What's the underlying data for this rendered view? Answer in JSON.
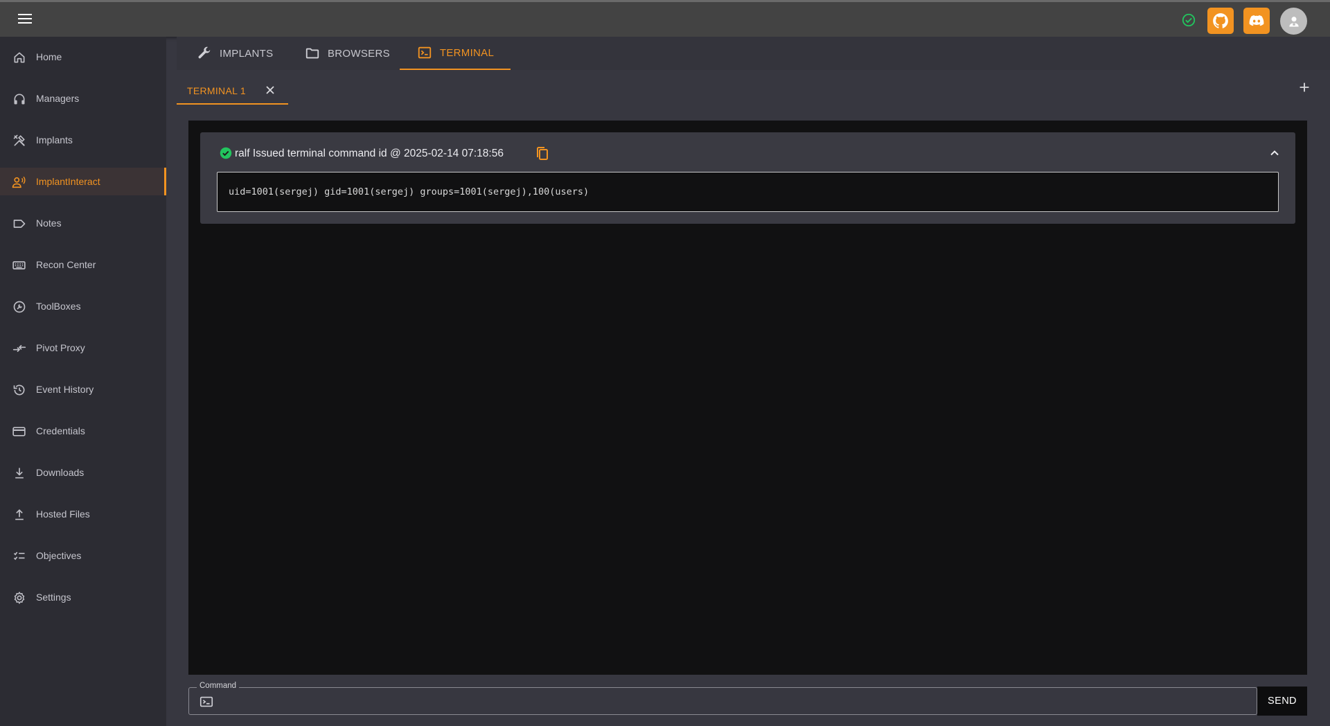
{
  "header": {
    "menu_icon": "hamburger-menu-icon",
    "status_icon": "check-circle-icon",
    "github_icon": "github-icon",
    "discord_icon": "discord-icon",
    "avatar_icon": "user-avatar-icon",
    "accent_color": "#f29321",
    "status_color": "#22c55e"
  },
  "sidebar": {
    "items": [
      {
        "label": "Home",
        "icon": "home-icon",
        "active": false
      },
      {
        "label": "Managers",
        "icon": "headphones-icon",
        "active": false
      },
      {
        "label": "Implants",
        "icon": "tools-icon",
        "active": false
      },
      {
        "label": "ImplantInteract",
        "icon": "person-interact-icon",
        "active": true
      },
      {
        "label": "Notes",
        "icon": "label-icon",
        "active": false
      },
      {
        "label": "Recon Center",
        "icon": "keyboard-icon",
        "active": false
      },
      {
        "label": "ToolBoxes",
        "icon": "wrench-circle-icon",
        "active": false
      },
      {
        "label": "Pivot Proxy",
        "icon": "arrows-icon",
        "active": false
      },
      {
        "label": "Event History",
        "icon": "history-icon",
        "active": false
      },
      {
        "label": "Credentials",
        "icon": "credit-card-icon",
        "active": false
      },
      {
        "label": "Downloads",
        "icon": "download-icon",
        "active": false
      },
      {
        "label": "Hosted Files",
        "icon": "upload-icon",
        "active": false
      },
      {
        "label": "Objectives",
        "icon": "checklist-icon",
        "active": false
      },
      {
        "label": "Settings",
        "icon": "gear-icon",
        "active": false
      }
    ]
  },
  "tabs": [
    {
      "label": "IMPLANTS",
      "icon": "wrench-icon",
      "active": false
    },
    {
      "label": "BROWSERS",
      "icon": "folder-icon",
      "active": false
    },
    {
      "label": "TERMINAL",
      "icon": "terminal-icon",
      "active": true
    }
  ],
  "terminal_tabs": [
    {
      "label": "TERMINAL 1",
      "active": true
    }
  ],
  "entry": {
    "header": "ralf Issued terminal command id @ 2025-02-14 07:18:56",
    "output": "uid=1001(sergej) gid=1001(sergej) groups=1001(sergej),100(users)"
  },
  "command": {
    "label": "Command",
    "value": "",
    "send_label": "SEND"
  }
}
